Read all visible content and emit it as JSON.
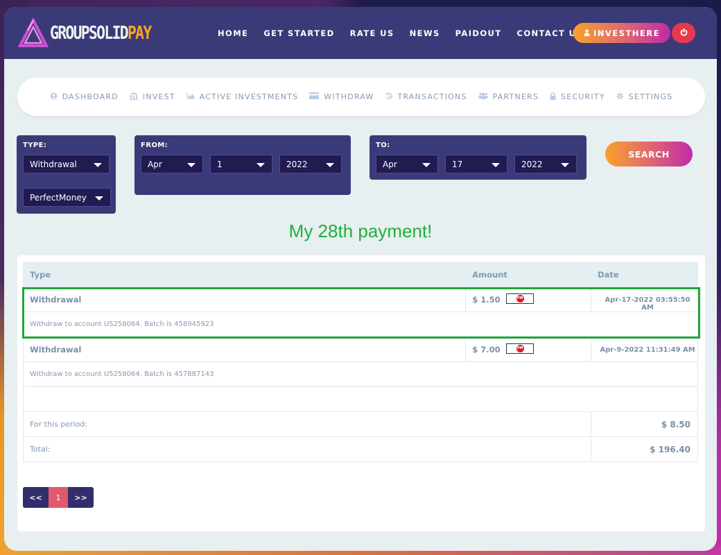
{
  "brand": {
    "name_main": "GROUPSOLID",
    "name_accent": "PAY",
    "accent_color": "#f5a623",
    "logo_color": "#d24fd8"
  },
  "nav": {
    "items": [
      {
        "label": "HOME"
      },
      {
        "label": "GET STARTED"
      },
      {
        "label": "RATE US"
      },
      {
        "label": "NEWS"
      },
      {
        "label": "PAIDOUT"
      },
      {
        "label": "CONTACT US"
      }
    ],
    "invest_button": {
      "label": "INVESTHERE",
      "icon": "user-icon"
    },
    "power_button": {
      "icon": "power-icon"
    }
  },
  "account_nav": {
    "items": [
      {
        "label": "DASHBOARD",
        "icon": "user-circle-icon"
      },
      {
        "label": "INVEST",
        "icon": "bank-icon"
      },
      {
        "label": "ACTIVE INVESTMENTS",
        "icon": "area-chart-icon"
      },
      {
        "label": "WITHDRAW",
        "icon": "credit-card-icon"
      },
      {
        "label": "TRANSACTIONS",
        "icon": "history-icon"
      },
      {
        "label": "PARTNERS",
        "icon": "users-icon"
      },
      {
        "label": "SECURITY",
        "icon": "lock-icon"
      },
      {
        "label": "SETTINGS",
        "icon": "gear-icon"
      }
    ]
  },
  "filters": {
    "type": {
      "label": "TYPE:",
      "type_value": "Withdrawal",
      "processor_value": "PerfectMoney"
    },
    "from": {
      "label": "FROM:",
      "month": "Apr",
      "day": "1",
      "year": "2022"
    },
    "to": {
      "label": "TO:",
      "month": "Apr",
      "day": "17",
      "year": "2022"
    },
    "search_label": "SEARCH"
  },
  "annotation": {
    "text": "My 28th payment!",
    "color": "#1fb03a"
  },
  "history": {
    "columns": [
      "Type",
      "Amount",
      "Date"
    ],
    "rows": [
      {
        "type": "Withdrawal",
        "amount": "$ 1.50",
        "processor_badge": "PM",
        "date": "Apr-17-2022 03:55:50 AM",
        "description": "Withdraw to account U5258064. Batch is 458945923",
        "highlighted": true
      },
      {
        "type": "Withdrawal",
        "amount": "$ 7.00",
        "processor_badge": "PM",
        "date": "Apr-9-2022 11:31:49 AM",
        "description": "Withdraw to account U5258064. Batch is 457887143",
        "highlighted": false
      }
    ],
    "period_label": "For this period:",
    "period_value": "$ 8.50",
    "total_label": "Total:",
    "total_value": "$ 196.40"
  },
  "pagination": {
    "prev_label": "<<",
    "current_page": "1",
    "next_label": ">>"
  }
}
